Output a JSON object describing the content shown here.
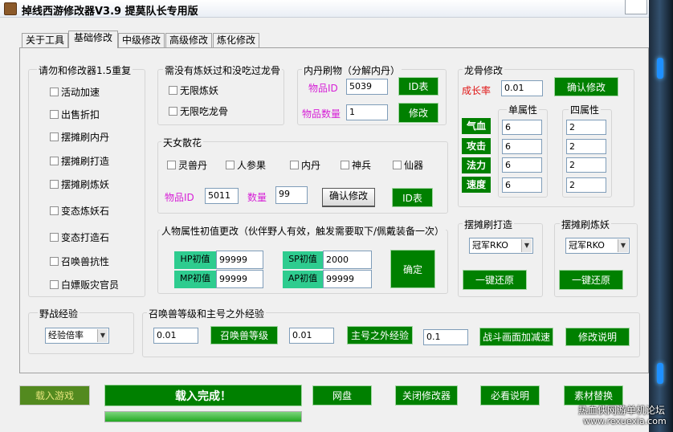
{
  "window": {
    "title": "掉线西游修改器V3.9  提莫队长专用版"
  },
  "tabs": [
    {
      "label": "关于工具"
    },
    {
      "label": "基础修改"
    },
    {
      "label": "中级修改"
    },
    {
      "label": "高级修改"
    },
    {
      "label": "炼化修改"
    }
  ],
  "repeat_group": {
    "title": "请勿和修改器1.5重复",
    "items": [
      {
        "label": "活动加速"
      },
      {
        "label": "出售折扣"
      },
      {
        "label": "摆摊刷内丹"
      },
      {
        "label": "摆摊刷打造"
      },
      {
        "label": "摆摊刷炼妖"
      },
      {
        "label": "变态炼妖石"
      },
      {
        "label": "变态打造石"
      },
      {
        "label": "召唤兽抗性"
      },
      {
        "label": "白嫖贩灾官员"
      }
    ]
  },
  "no_need_group": {
    "title": "需没有炼妖过和没吃过龙骨",
    "items": [
      {
        "label": "无限炼妖"
      },
      {
        "label": "无限吃龙骨"
      }
    ]
  },
  "neidan": {
    "title": "内丹刷物（分解内丹）",
    "item_id_label": "物品ID",
    "item_id_value": "5039",
    "id_table_button": "ID表",
    "qty_label": "物品数量",
    "qty_value": "1",
    "modify_button": "修改"
  },
  "fairy": {
    "title": "天女散花",
    "items": [
      {
        "label": "灵兽丹"
      },
      {
        "label": "人参果"
      },
      {
        "label": "内丹"
      },
      {
        "label": "神兵"
      },
      {
        "label": "仙器"
      }
    ],
    "item_id_label": "物品ID",
    "item_id_value": "5011",
    "qty_label": "数量",
    "qty_value": "99",
    "confirm_button": "确认修改",
    "id_table_button": "ID表"
  },
  "attr": {
    "title": "人物属性初值更改（伙伴野人有效，触发需要取下/佩戴装备一次）",
    "hp_label": "HP初值",
    "hp_value": "99999",
    "mp_label": "MP初值",
    "mp_value": "99999",
    "sp_label": "SP初值",
    "sp_value": "2000",
    "ap_label": "AP初值",
    "ap_value": "99999",
    "confirm_button": "确定"
  },
  "dragon": {
    "title": "龙骨修改",
    "growth_label": "成长率",
    "growth_value": "0.01",
    "confirm_button": "确认修改",
    "single_title": "单属性",
    "quad_title": "四属性",
    "rows": [
      {
        "label": "气血",
        "single": "6",
        "quad": "2"
      },
      {
        "label": "攻击",
        "single": "6",
        "quad": "2"
      },
      {
        "label": "法力",
        "single": "6",
        "quad": "2"
      },
      {
        "label": "速度",
        "single": "6",
        "quad": "2"
      }
    ]
  },
  "stall_forge": {
    "title": "摆摊刷打造",
    "select_value": "冠军RKO",
    "restore_button": "一键还原"
  },
  "stall_refine": {
    "title": "摆摊刷炼妖",
    "select_value": "冠军RKO",
    "restore_button": "一键还原"
  },
  "wild_exp": {
    "title": "野战经验",
    "select_value": "经验倍率"
  },
  "summon_exp": {
    "title": "召唤兽等级和主号之外经验",
    "level_value": "0.01",
    "level_button": "召唤兽等级",
    "main_value": "0.01",
    "main_button": "主号之外经验",
    "battle_value": "0.1",
    "battle_button": "战斗画面加减速",
    "explain_button": "修改说明"
  },
  "bottom": {
    "load_game": "载入游戏",
    "status": "载入完成！",
    "netdisk": "网盘",
    "close_tool": "关闭修改器",
    "must_read": "必看说明",
    "material": "素材替换",
    "progress_percent": 100
  },
  "watermark": {
    "line1": "热血侠网游单机论坛",
    "line2": "www.rexuexia.com"
  }
}
